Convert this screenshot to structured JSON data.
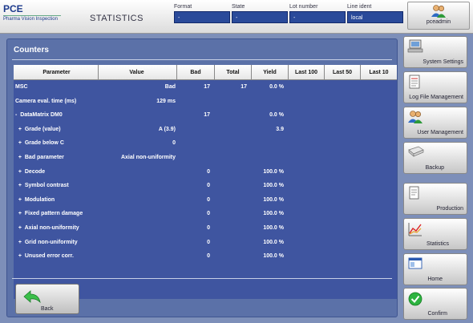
{
  "header": {
    "logo_main": "PCE",
    "logo_sub": "Pharma Vision Inspection",
    "title": "STATISTICS",
    "fields": [
      {
        "label": "Format",
        "value": "-"
      },
      {
        "label": "State",
        "value": "-"
      },
      {
        "label": "Lot number",
        "value": "-"
      },
      {
        "label": "Line ident",
        "value": "local"
      }
    ],
    "user": "pceadmin"
  },
  "panel": {
    "title": "Counters",
    "columns": [
      "Parameter",
      "Value",
      "Bad",
      "Total",
      "Yield",
      "Last 100",
      "Last 50",
      "Last 10"
    ],
    "rows": [
      {
        "param": "MSC",
        "value": "Bad",
        "bad": "17",
        "total": "17",
        "yield": "0.0 %"
      },
      {
        "param": "Camera eval. time (ms)",
        "value": "129 ms",
        "bad": "",
        "total": "",
        "yield": ""
      },
      {
        "param": "-  DataMatrix DM0",
        "value": "",
        "bad": "17",
        "total": "",
        "yield": "0.0 %"
      },
      {
        "param": "  +  Grade (value)",
        "value": "A  (3.9)",
        "bad": "",
        "total": "",
        "yield": "3.9"
      },
      {
        "param": "  +  Grade below C",
        "value": "0",
        "bad": "",
        "total": "",
        "yield": ""
      },
      {
        "param": "  +  Bad parameter",
        "value": "Axial non-uniformity",
        "bad": "",
        "total": "",
        "yield": ""
      },
      {
        "param": "  +  Decode",
        "value": "",
        "bad": "0",
        "total": "",
        "yield": "100.0 %"
      },
      {
        "param": "  +  Symbol contrast",
        "value": "",
        "bad": "0",
        "total": "",
        "yield": "100.0 %"
      },
      {
        "param": "  +  Modulation",
        "value": "",
        "bad": "0",
        "total": "",
        "yield": "100.0 %"
      },
      {
        "param": "  +  Fixed pattern damage",
        "value": "",
        "bad": "0",
        "total": "",
        "yield": "100.0 %"
      },
      {
        "param": "  +  Axial non-uniformity",
        "value": "",
        "bad": "0",
        "total": "",
        "yield": "100.0 %"
      },
      {
        "param": "  +  Grid non-uniformity",
        "value": "",
        "bad": "0",
        "total": "",
        "yield": "100.0 %"
      },
      {
        "param": "  +  Unused error corr.",
        "value": "",
        "bad": "0",
        "total": "",
        "yield": "100.0 %"
      }
    ],
    "back_label": "Back"
  },
  "sidebar": [
    {
      "label": "System Settings",
      "icon": "computer-icon"
    },
    {
      "label": "Log File Management",
      "icon": "log-file-icon"
    },
    {
      "label": "User Management",
      "icon": "users-icon"
    },
    {
      "label": "Backup",
      "icon": "backup-icon"
    },
    {
      "label": "Production",
      "icon": "production-icon"
    },
    {
      "label": "Statistics",
      "icon": "chart-icon"
    },
    {
      "label": "Home",
      "icon": "home-icon"
    },
    {
      "label": "Confirm",
      "icon": "checkmark-icon"
    }
  ]
}
